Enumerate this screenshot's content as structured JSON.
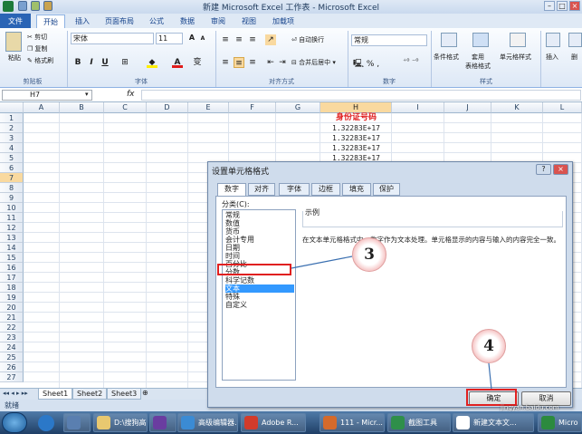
{
  "window": {
    "title": "新建 Microsoft Excel 工作表 - Microsoft Excel"
  },
  "ribbon_tabs": [
    "文件",
    "开始",
    "插入",
    "页面布局",
    "公式",
    "数据",
    "审阅",
    "视图",
    "加载项"
  ],
  "ribbon": {
    "paste": "粘贴",
    "cut": "剪切",
    "copy": "复制",
    "format_painter": "格式刷",
    "font_name": "宋体",
    "font_size": "11",
    "wrap_text": "自动换行",
    "merge_center": "合并后居中",
    "number_format": "常规",
    "conditional_format": "条件格式",
    "table_format": "套用\n表格格式",
    "cell_styles": "单元格样式",
    "insert": "插入",
    "delete": "删",
    "groups": {
      "clipboard": "剪贴板",
      "font": "字体",
      "alignment": "对齐方式",
      "number": "数字",
      "styles": "样式"
    }
  },
  "formula_bar": {
    "name_box": "H7",
    "fx": "fx"
  },
  "grid": {
    "columns": [
      "A",
      "B",
      "C",
      "D",
      "E",
      "F",
      "G",
      "H",
      "I",
      "J",
      "K",
      "L"
    ],
    "rows": [
      "1",
      "2",
      "3",
      "4",
      "5",
      "6",
      "7",
      "8",
      "9",
      "10",
      "11",
      "12",
      "13",
      "14",
      "15",
      "16",
      "17",
      "18",
      "19",
      "20",
      "21",
      "22",
      "23",
      "24",
      "25",
      "26",
      "27"
    ],
    "selected_row": "7",
    "selected_col": "H",
    "h1": "身份证号码",
    "h_values": [
      "1.32283E+17",
      "1.32283E+17",
      "1.32283E+17",
      "1.32283E+17"
    ]
  },
  "sheets": [
    "Sheet1",
    "Sheet2",
    "Sheet3"
  ],
  "status": "就绪",
  "dialog": {
    "title": "设置单元格格式",
    "tabs": [
      "数字",
      "对齐",
      "字体",
      "边框",
      "填充",
      "保护"
    ],
    "category_label": "分类(C):",
    "categories": [
      "常规",
      "数值",
      "货币",
      "会计专用",
      "日期",
      "时间",
      "百分比",
      "分数",
      "科学记数",
      "文本",
      "特殊",
      "自定义"
    ],
    "selected_category": "文本",
    "sample_label": "示例",
    "description": "在文本单元格格式中，数字作为文本处理。单元格显示的内容与输入的内容完全一致。",
    "ok": "确定",
    "cancel": "取消"
  },
  "callouts": [
    "3",
    "4"
  ],
  "taskbar": [
    "D:\\搜狗高...",
    "",
    "高级编辑器...",
    "Adobe R...",
    "111 - Micr...",
    "截图工具",
    "新建文本文...",
    "Micro"
  ],
  "watermark": "jingyan.baidu.com",
  "colors": {
    "header_red": "#e01b1b",
    "selection": "#f9d99f",
    "callout_red": "#e02020"
  }
}
